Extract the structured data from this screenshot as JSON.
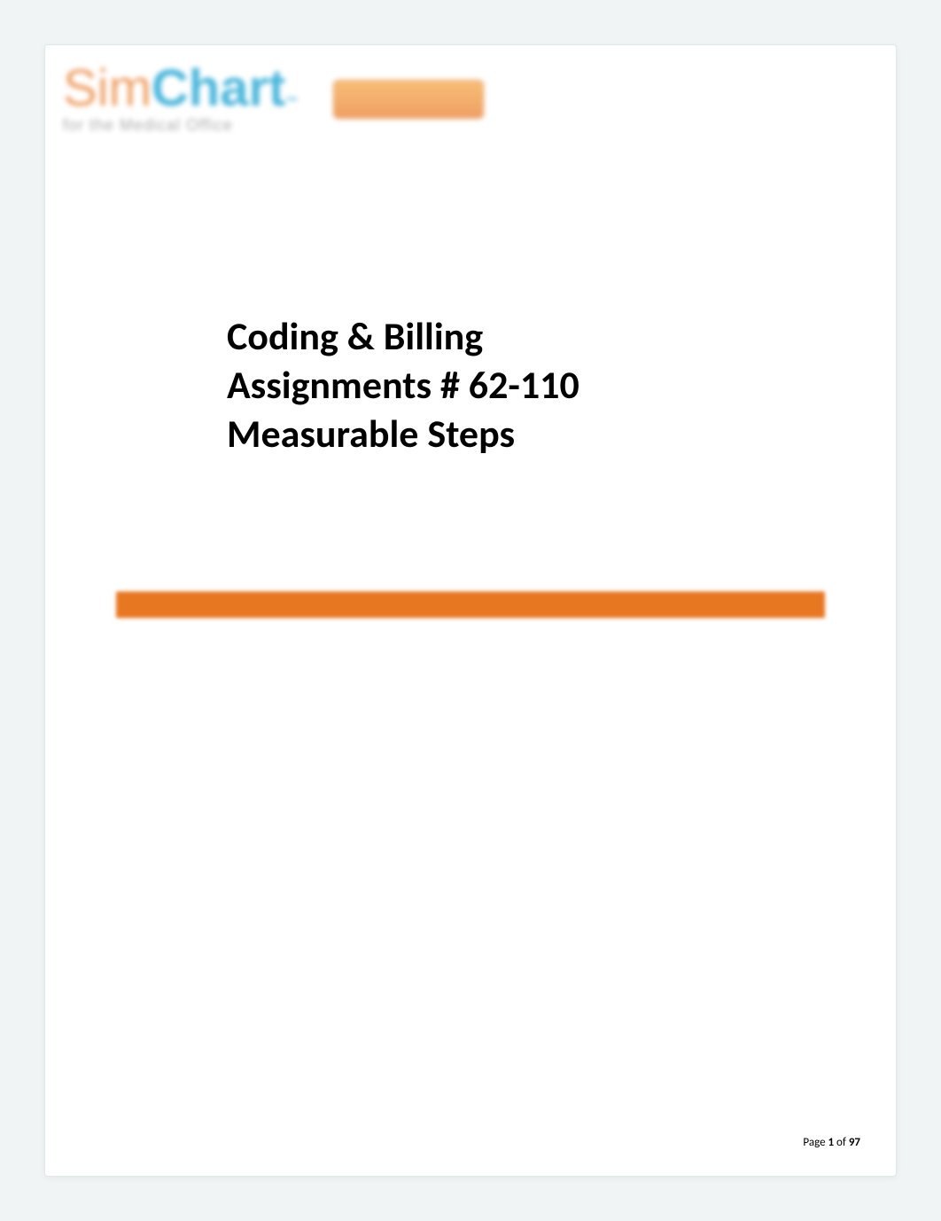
{
  "logo": {
    "part1": "Sim",
    "part2": "Chart",
    "trademark": "™",
    "tagline": "for the Medical Office"
  },
  "title": {
    "line1": "Coding & Billing",
    "line2": "Assignments # 62-110",
    "line3": "Measurable Steps"
  },
  "footer": {
    "prefix": "Page ",
    "current": "1",
    "separator": " of ",
    "total": "97"
  }
}
